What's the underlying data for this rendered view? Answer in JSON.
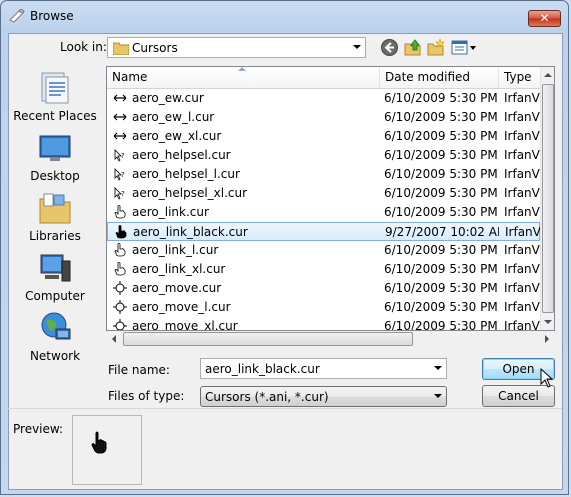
{
  "window": {
    "title": "Browse",
    "close_label": "✕"
  },
  "lookin": {
    "label": "Look in:",
    "value": "Cursors"
  },
  "places": [
    {
      "label": "Recent Places",
      "icon": "recent-places-icon"
    },
    {
      "label": "Desktop",
      "icon": "desktop-icon"
    },
    {
      "label": "Libraries",
      "icon": "libraries-icon"
    },
    {
      "label": "Computer",
      "icon": "computer-icon"
    },
    {
      "label": "Network",
      "icon": "network-icon"
    }
  ],
  "columns": {
    "name": "Name",
    "date": "Date modified",
    "type": "Type"
  },
  "files": [
    {
      "name": "aero_ew.cur",
      "date": "6/10/2009 5:30 PM",
      "type": "IrfanVi"
    },
    {
      "name": "aero_ew_l.cur",
      "date": "6/10/2009 5:30 PM",
      "type": "IrfanVi"
    },
    {
      "name": "aero_ew_xl.cur",
      "date": "6/10/2009 5:30 PM",
      "type": "IrfanVi"
    },
    {
      "name": "aero_helpsel.cur",
      "date": "6/10/2009 5:30 PM",
      "type": "IrfanVi"
    },
    {
      "name": "aero_helpsel_l.cur",
      "date": "6/10/2009 5:30 PM",
      "type": "IrfanVi"
    },
    {
      "name": "aero_helpsel_xl.cur",
      "date": "6/10/2009 5:30 PM",
      "type": "IrfanVi"
    },
    {
      "name": "aero_link.cur",
      "date": "6/10/2009 5:30 PM",
      "type": "IrfanVi"
    },
    {
      "name": "aero_link_black.cur",
      "date": "9/27/2007 10:02 AM",
      "type": "IrfanVi"
    },
    {
      "name": "aero_link_l.cur",
      "date": "6/10/2009 5:30 PM",
      "type": "IrfanVi"
    },
    {
      "name": "aero_link_xl.cur",
      "date": "6/10/2009 5:30 PM",
      "type": "IrfanVi"
    },
    {
      "name": "aero_move.cur",
      "date": "6/10/2009 5:30 PM",
      "type": "IrfanVi"
    },
    {
      "name": "aero_move_l.cur",
      "date": "6/10/2009 5:30 PM",
      "type": "IrfanVi"
    },
    {
      "name": "aero_move_xl.cur",
      "date": "6/10/2009 5:30 PM",
      "type": "IrfanVi"
    }
  ],
  "file_icons": [
    "ew",
    "ew",
    "ew",
    "help",
    "help",
    "help",
    "link",
    "link",
    "link",
    "link",
    "move",
    "move",
    "move"
  ],
  "selected_index": 7,
  "filename": {
    "label": "File name:",
    "value": "aero_link_black.cur"
  },
  "filetype": {
    "label": "Files of type:",
    "value": "Cursors (*.ani, *.cur)"
  },
  "buttons": {
    "open": "Open",
    "cancel": "Cancel"
  },
  "preview": {
    "label": "Preview:"
  }
}
